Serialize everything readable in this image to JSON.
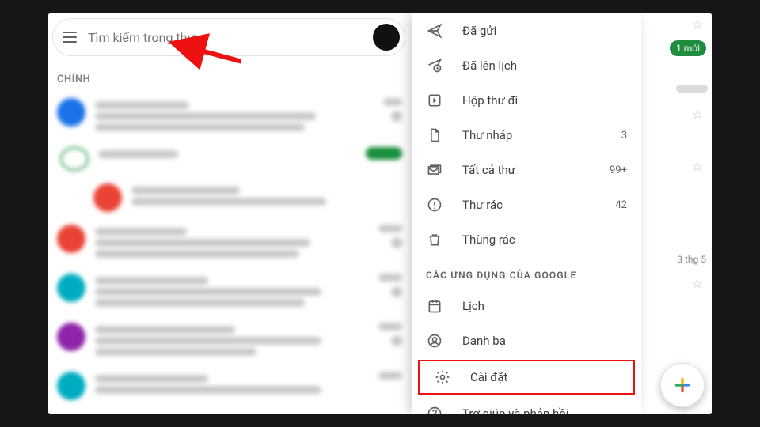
{
  "search": {
    "placeholder": "Tìm kiếm trong thư"
  },
  "section_primary": "CHÍNH",
  "menu": {
    "sent": "Đã gửi",
    "scheduled": "Đã lên lịch",
    "outbox": "Hộp thư đi",
    "drafts": "Thư nháp",
    "drafts_count": "3",
    "allmail": "Tất cả thư",
    "allmail_count": "99+",
    "spam": "Thư rác",
    "spam_count": "42",
    "trash": "Thùng rác",
    "apps_header": "CÁC ỨNG DỤNG CỦA GOOGLE",
    "calendar": "Lịch",
    "contacts": "Danh bạ",
    "settings": "Cài đặt",
    "help": "Trợ giúp và phản hồi"
  },
  "right": {
    "badge": "1 mới",
    "date_preview": "3 thg 5"
  }
}
